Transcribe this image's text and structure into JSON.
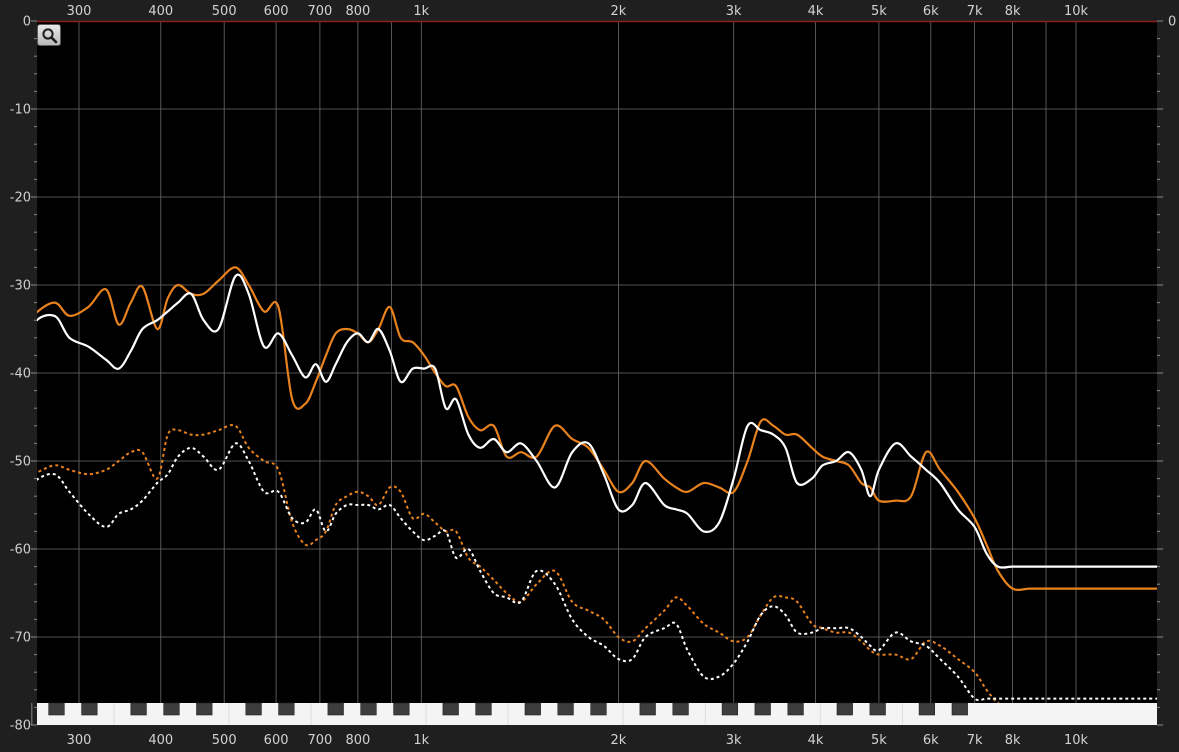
{
  "chart_data": {
    "type": "line",
    "x_scale": "log",
    "xlim": [
      240,
      13500
    ],
    "ylim": [
      -80,
      0
    ],
    "grid": true,
    "x_tick_labels": [
      {
        "value": 300,
        "label": "300"
      },
      {
        "value": 400,
        "label": "400"
      },
      {
        "value": 500,
        "label": "500"
      },
      {
        "value": 600,
        "label": "600"
      },
      {
        "value": 700,
        "label": "700"
      },
      {
        "value": 800,
        "label": "800"
      },
      {
        "value": 1000,
        "label": "1k"
      },
      {
        "value": 2000,
        "label": "2k"
      },
      {
        "value": 3000,
        "label": "3k"
      },
      {
        "value": 4000,
        "label": "4k"
      },
      {
        "value": 5000,
        "label": "5k"
      },
      {
        "value": 6000,
        "label": "6k"
      },
      {
        "value": 7000,
        "label": "7k"
      },
      {
        "value": 8000,
        "label": "8k"
      },
      {
        "value": 10000,
        "label": "10k"
      }
    ],
    "x_minor_gridlines": [
      900,
      9000
    ],
    "y_tick_labels": [
      {
        "value": 0,
        "label": "0"
      },
      {
        "value": -10,
        "label": "-10"
      },
      {
        "value": -20,
        "label": "-20"
      },
      {
        "value": -30,
        "label": "-30"
      },
      {
        "value": -40,
        "label": "-40"
      },
      {
        "value": -50,
        "label": "-50"
      },
      {
        "value": -60,
        "label": "-60"
      },
      {
        "value": -70,
        "label": "-70"
      },
      {
        "value": -80,
        "label": "-80"
      }
    ],
    "right_y_tick_labels": [
      {
        "value": 0,
        "label": "0"
      }
    ],
    "series": [
      {
        "color": "#e8821e",
        "dashed": false,
        "x": [
          240,
          255,
          275,
          290,
          310,
          330,
          345,
          360,
          375,
          395,
          410,
          425,
          445,
          465,
          490,
          520,
          545,
          575,
          605,
          635,
          665,
          690,
          715,
          740,
          770,
          800,
          830,
          860,
          895,
          930,
          970,
          1010,
          1050,
          1090,
          1130,
          1180,
          1230,
          1290,
          1350,
          1420,
          1500,
          1600,
          1700,
          1800,
          1900,
          2000,
          2100,
          2200,
          2350,
          2450,
          2550,
          2700,
          2850,
          3000,
          3150,
          3300,
          3450,
          3600,
          3750,
          3950,
          4100,
          4300,
          4500,
          4700,
          4850,
          5000,
          5300,
          5600,
          5900,
          6200,
          6600,
          7000,
          7300,
          7600,
          8000,
          8500,
          9000,
          9500,
          10000,
          10500,
          11000,
          11700,
          12300,
          12800,
          13500
        ],
        "y": [
          -36,
          -33.5,
          -32,
          -33.5,
          -32.5,
          -30.5,
          -34.5,
          -32,
          -30.2,
          -35,
          -31.5,
          -30,
          -31,
          -31,
          -29.5,
          -28,
          -30,
          -33,
          -32.5,
          -43,
          -43.5,
          -41,
          -38,
          -35.5,
          -35,
          -35.5,
          -36.5,
          -35,
          -32.5,
          -36,
          -36.5,
          -38,
          -40,
          -41.5,
          -41.5,
          -45,
          -46.5,
          -46,
          -49.5,
          -49,
          -49.5,
          -46,
          -47.5,
          -48.5,
          -51,
          -53.5,
          -52.5,
          -50,
          -52,
          -53,
          -53.5,
          -52.5,
          -53,
          -53.5,
          -50,
          -45.5,
          -46,
          -47,
          -47,
          -48.5,
          -49.5,
          -50,
          -50.5,
          -52.5,
          -53,
          -54.5,
          -54.5,
          -54,
          -49,
          -51,
          -53.5,
          -56.5,
          -59.5,
          -62.5,
          -64.5,
          -64.5,
          -64.5,
          -64.5,
          -64.5,
          -64.5,
          -64.5,
          -64.5,
          -64.5,
          -64.5,
          -64.5
        ]
      },
      {
        "color": "#ffffff",
        "dashed": false,
        "x": [
          240,
          255,
          275,
          290,
          310,
          330,
          345,
          360,
          375,
          395,
          410,
          425,
          445,
          465,
          490,
          520,
          545,
          575,
          605,
          635,
          665,
          690,
          715,
          740,
          770,
          800,
          830,
          860,
          895,
          930,
          970,
          1010,
          1050,
          1090,
          1130,
          1180,
          1230,
          1290,
          1350,
          1420,
          1500,
          1600,
          1700,
          1800,
          1900,
          2000,
          2100,
          2200,
          2350,
          2450,
          2550,
          2700,
          2850,
          3000,
          3150,
          3300,
          3450,
          3600,
          3750,
          3950,
          4100,
          4300,
          4500,
          4700,
          4850,
          5000,
          5300,
          5600,
          5900,
          6200,
          6600,
          7000,
          7300,
          7600,
          8000,
          8500,
          9000,
          9500,
          10000,
          10500,
          11000,
          11700,
          12300,
          12800,
          13500
        ],
        "y": [
          -39.5,
          -34.5,
          -33.5,
          -36,
          -37,
          -38.5,
          -39.5,
          -37.5,
          -35,
          -34,
          -33,
          -32,
          -31,
          -34,
          -35,
          -29,
          -31,
          -37,
          -35.5,
          -38,
          -40.5,
          -39,
          -41,
          -39,
          -36.5,
          -35.5,
          -36.5,
          -35,
          -37.5,
          -41,
          -39.5,
          -39.5,
          -39.5,
          -44,
          -43,
          -47,
          -48.5,
          -47.5,
          -49,
          -48,
          -50,
          -53,
          -49,
          -48,
          -51.5,
          -55.5,
          -55,
          -52.5,
          -55,
          -55.5,
          -56,
          -58,
          -57,
          -52,
          -46,
          -46.5,
          -47,
          -48.5,
          -52.5,
          -52,
          -50.5,
          -50,
          -49,
          -51,
          -54,
          -51,
          -48,
          -49.5,
          -51,
          -52.5,
          -55.5,
          -57.5,
          -60.5,
          -62,
          -62,
          -62,
          -62,
          -62,
          -62,
          -62,
          -62,
          -62,
          -62,
          -62,
          -62
        ]
      },
      {
        "color": "#e8821e",
        "dashed": true,
        "x": [
          240,
          255,
          275,
          290,
          310,
          330,
          345,
          360,
          375,
          395,
          410,
          425,
          445,
          465,
          490,
          520,
          545,
          575,
          605,
          635,
          665,
          690,
          715,
          740,
          770,
          800,
          830,
          860,
          895,
          930,
          970,
          1010,
          1050,
          1090,
          1130,
          1180,
          1230,
          1290,
          1350,
          1420,
          1500,
          1600,
          1700,
          1800,
          1900,
          2000,
          2100,
          2200,
          2350,
          2450,
          2550,
          2700,
          2850,
          3000,
          3150,
          3300,
          3450,
          3600,
          3750,
          3950,
          4100,
          4300,
          4500,
          4700,
          4850,
          5000,
          5300,
          5600,
          5900,
          6200,
          6600,
          7000,
          7300,
          7600,
          8000,
          8500,
          9000,
          9500,
          10000,
          10500,
          11000,
          11700,
          12300,
          12800,
          13500
        ],
        "y": [
          -52,
          -51.5,
          -50.5,
          -51,
          -51.5,
          -51,
          -50,
          -49,
          -49,
          -52,
          -47,
          -46.5,
          -47,
          -47,
          -46.5,
          -46,
          -48.5,
          -50,
          -51,
          -57,
          -59.5,
          -59,
          -58,
          -55,
          -54,
          -53.5,
          -54,
          -55,
          -53,
          -53.5,
          -56.5,
          -56,
          -57,
          -58,
          -58,
          -61,
          -62,
          -63.5,
          -65,
          -66,
          -64,
          -62.5,
          -66,
          -67,
          -68,
          -70,
          -70.5,
          -69,
          -67,
          -65.5,
          -66.5,
          -68.5,
          -69.5,
          -70.5,
          -70,
          -67.5,
          -65.5,
          -65.5,
          -66,
          -68.5,
          -69,
          -69.5,
          -69.5,
          -70.5,
          -71.5,
          -72,
          -72,
          -72.5,
          -70.5,
          -71,
          -72.5,
          -74,
          -76,
          -77.5,
          -78.5,
          -78.5,
          -78.5,
          -78.5,
          -78.5,
          -78.5,
          -78.5,
          -78.5,
          -78.5,
          -78.5,
          -78.5
        ]
      },
      {
        "color": "#ffffff",
        "dashed": true,
        "x": [
          240,
          255,
          275,
          290,
          310,
          330,
          345,
          360,
          375,
          395,
          410,
          425,
          445,
          465,
          490,
          520,
          545,
          575,
          605,
          635,
          665,
          690,
          715,
          740,
          770,
          800,
          830,
          860,
          895,
          930,
          970,
          1010,
          1050,
          1090,
          1130,
          1180,
          1230,
          1290,
          1350,
          1420,
          1500,
          1600,
          1700,
          1800,
          1900,
          2000,
          2100,
          2200,
          2350,
          2450,
          2550,
          2700,
          2850,
          3000,
          3150,
          3300,
          3450,
          3600,
          3750,
          3950,
          4100,
          4300,
          4500,
          4700,
          4850,
          5000,
          5300,
          5600,
          5900,
          6200,
          6600,
          7000,
          7300,
          7600,
          8000,
          8500,
          9000,
          9500,
          10000,
          10500,
          11000,
          11700,
          12300,
          12800,
          13500
        ],
        "y": [
          -55.5,
          -52.5,
          -51.5,
          -53.5,
          -56,
          -57.5,
          -56,
          -55.5,
          -54.5,
          -52.5,
          -51.5,
          -49.5,
          -48.5,
          -49.5,
          -51,
          -48,
          -50,
          -53.5,
          -53.5,
          -56.5,
          -57,
          -55.5,
          -58,
          -56,
          -55,
          -55,
          -55,
          -55.5,
          -55,
          -56.5,
          -58,
          -59,
          -58.5,
          -58,
          -61,
          -60,
          -62.5,
          -65,
          -65.5,
          -66,
          -62.5,
          -64,
          -68,
          -70,
          -71,
          -72.5,
          -72.5,
          -70,
          -69,
          -68.5,
          -71.5,
          -74.5,
          -74.5,
          -73,
          -70.5,
          -67.5,
          -66.5,
          -67.5,
          -69.5,
          -69.5,
          -69,
          -69,
          -69,
          -70,
          -71,
          -71.5,
          -69.5,
          -70.5,
          -71,
          -72.5,
          -74.5,
          -77,
          -77,
          -77,
          -77,
          -77,
          -77,
          -77,
          -77,
          -77,
          -77,
          -77,
          -77,
          -77,
          -77
        ]
      }
    ],
    "piano_keyboard": {
      "shown": true,
      "black_key_color": "#3d3d3d",
      "white_key_color": "#f4f4f4"
    }
  },
  "zoom_button": {
    "icon": "magnifier-icon"
  },
  "colors": {
    "background": "#000000",
    "frame": "#1f1f1f",
    "grid": "#6a6a6a",
    "top_line": "#8a2020",
    "orange": "#e8821e",
    "white": "#ffffff"
  }
}
